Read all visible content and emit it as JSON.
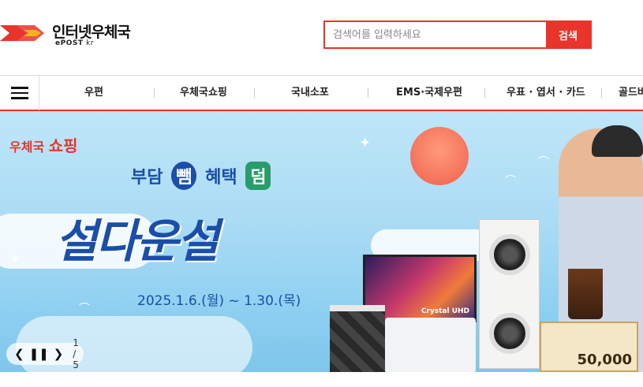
{
  "header": {
    "logo_title": "인터넷우체국",
    "logo_sub_brand": "ePOST",
    "logo_sub_domain": "kr"
  },
  "search": {
    "placeholder": "검색어를 입력하세요",
    "button_label": "검색"
  },
  "nav": {
    "items": [
      "우편",
      "우체국쇼핑",
      "국내소포",
      "EMS·국제우편",
      "우표 · 엽서 · 카드",
      "골드바"
    ]
  },
  "banner": {
    "shop_logo_prefix": "우체국",
    "shop_logo_main": "쇼핑",
    "tagline_1": "부담",
    "badge_1": "뺌",
    "tagline_2": "혜택",
    "badge_2": "덤",
    "headline": "설다운설",
    "date": "2025.1.6.(월) ~ 1.30.(목)",
    "tv_label": "Crystal UHD",
    "gift_value": "50,000",
    "slide_counter": "1 / 5"
  },
  "colors": {
    "brand_red": "#e8342a",
    "banner_blue": "#1b4ea8"
  }
}
